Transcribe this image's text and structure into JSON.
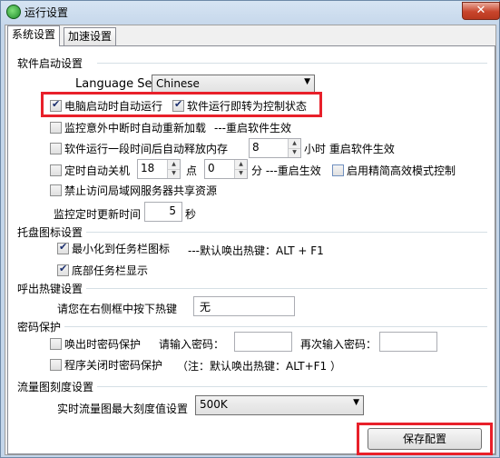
{
  "window": {
    "title": "运行设置",
    "close_glyph": "✕"
  },
  "tabs": [
    {
      "label": "系统设置",
      "active": true
    },
    {
      "label": "加速设置",
      "active": false
    }
  ],
  "startup": {
    "title": "软件启动设置",
    "language_label": "Language Select:",
    "language_value": "Chinese",
    "auto_run": {
      "label": "电脑启动时自动运行",
      "checked": true
    },
    "control_state": {
      "label": "软件运行即转为控制状态",
      "checked": true
    },
    "reload_on_crash": {
      "label": "监控意外中断时自动重新加载",
      "checked": false
    },
    "reload_note": "---重启软件生效",
    "release_memory": {
      "label": "软件运行一段时间后自动释放内存",
      "checked": false
    },
    "release_hours": "8",
    "release_unit": "小时 重启软件生效",
    "auto_shutdown": {
      "label": "定时自动关机",
      "checked": false
    },
    "shutdown_hour": "18",
    "shutdown_hour_unit": "点",
    "shutdown_min": "0",
    "shutdown_min_unit": "分 ---重启生效",
    "simple_mode": {
      "label": "启用精简高效模式控制",
      "checked": false
    },
    "block_lan_share": {
      "label": "禁止访问局域网服务器共享资源",
      "checked": false
    },
    "refresh_label": "监控定时更新时间",
    "refresh_value": "5",
    "refresh_unit": "秒"
  },
  "tray": {
    "title": "托盘图标设置",
    "minimize_to_tray": {
      "label": "最小化到任务栏图标",
      "checked": true
    },
    "hotkey_note": "---默认唤出热键：ALT + F1",
    "taskbar_show": {
      "label": "底部任务栏显示",
      "checked": true
    }
  },
  "hotkey": {
    "title": "呼出热键设置",
    "prompt": "请您在右侧框中按下热键",
    "value": "无"
  },
  "password": {
    "title": "密码保护",
    "wake_protect": {
      "label": "唤出时密码保护",
      "checked": false
    },
    "enter_label": "请输入密码：",
    "reenter_label": "再次输入密码：",
    "close_protect": {
      "label": "程序关闭时密码保护",
      "checked": false
    },
    "note": "（注：默认唤出热键：ALT+F1 ）"
  },
  "traffic": {
    "title": "流量图刻度设置",
    "scale_label": "实时流量图最大刻度值设置",
    "scale_value": "500K"
  },
  "footer": {
    "save_label": "保存配置"
  },
  "icons": {
    "app": "app-globe-icon",
    "dropdown": "chevron-down-icon",
    "spin_up": "spin-up-icon",
    "spin_down": "spin-down-icon"
  },
  "colors": {
    "highlight": "#e8202a",
    "window_frame": "#c4d6ea"
  }
}
